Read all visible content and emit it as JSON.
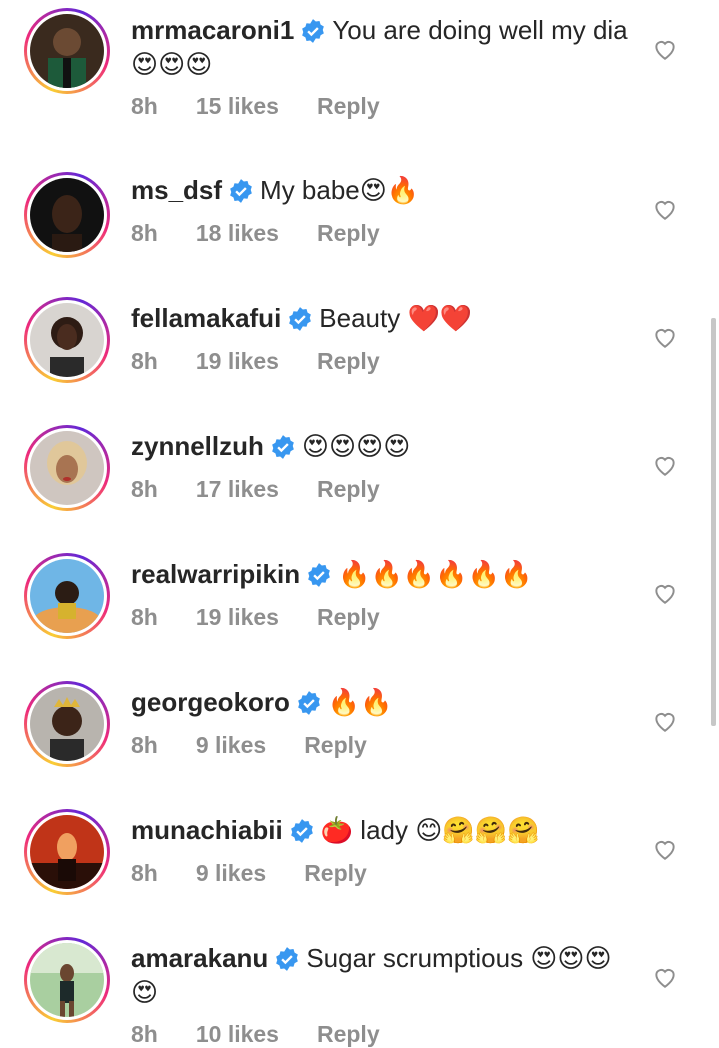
{
  "comments": [
    {
      "username": "mrmacaroni1",
      "text": "You are doing well my dia 😍😍😍",
      "time": "8h",
      "likes": "15 likes",
      "reply": "Reply"
    },
    {
      "username": "ms_dsf",
      "text": "My babe😍🔥",
      "time": "8h",
      "likes": "18 likes",
      "reply": "Reply"
    },
    {
      "username": "fellamakafui",
      "text": "Beauty ❤️❤️",
      "time": "8h",
      "likes": "19 likes",
      "reply": "Reply"
    },
    {
      "username": "zynnellzuh",
      "text": "😍😍😍😍",
      "time": "8h",
      "likes": "17 likes",
      "reply": "Reply"
    },
    {
      "username": "realwarripikin",
      "text": "🔥🔥🔥🔥🔥🔥",
      "time": "8h",
      "likes": "19 likes",
      "reply": "Reply"
    },
    {
      "username": "georgeokoro",
      "text": "🔥🔥",
      "time": "8h",
      "likes": "9 likes",
      "reply": "Reply"
    },
    {
      "username": "munachiabii",
      "text": "🍅 lady 😊🤗🤗🤗",
      "time": "8h",
      "likes": "9 likes",
      "reply": "Reply"
    },
    {
      "username": "amarakanu",
      "text": "Sugar scrumptious 😍😍😍😍",
      "time": "8h",
      "likes": "10 likes",
      "reply": "Reply"
    }
  ],
  "icons": {
    "verified": "verified-badge-icon",
    "like": "heart-outline-icon"
  },
  "colors": {
    "verified": "#3897f0",
    "meta": "#8e8e8e",
    "text": "#262626"
  }
}
